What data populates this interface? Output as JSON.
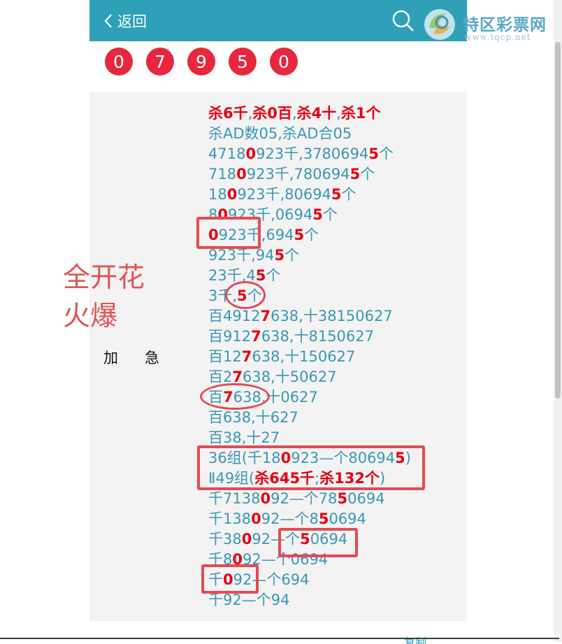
{
  "header": {
    "back_label": "返回",
    "logo_name": "特区彩票网",
    "logo_url": "www.tqcp.net"
  },
  "balls": [
    "0",
    "7",
    "9",
    "5",
    "0"
  ],
  "annotation": {
    "line1": "全开花",
    "line2": "火爆"
  },
  "urgent_label": "加急",
  "lines": [
    [
      [
        "杀6千",
        1
      ],
      [
        ",",
        0
      ],
      [
        "杀0百",
        1
      ],
      [
        ",",
        0
      ],
      [
        "杀4十",
        1
      ],
      [
        ",",
        0
      ],
      [
        "杀1个",
        1
      ]
    ],
    [
      [
        "杀AD数05,杀AD合05",
        0
      ]
    ],
    [
      [
        "4718",
        0
      ],
      [
        "0",
        1
      ],
      [
        "923千,3780694",
        0
      ],
      [
        "5",
        1
      ],
      [
        "个",
        0
      ]
    ],
    [
      [
        "718",
        0
      ],
      [
        "0",
        1
      ],
      [
        "923千,780694",
        0
      ],
      [
        "5",
        1
      ],
      [
        "个",
        0
      ]
    ],
    [
      [
        "18",
        0
      ],
      [
        "0",
        1
      ],
      [
        "923千,80694",
        0
      ],
      [
        "5",
        1
      ],
      [
        "个",
        0
      ]
    ],
    [
      [
        "8",
        0
      ],
      [
        "0",
        1
      ],
      [
        "923千,0694",
        0
      ],
      [
        "5",
        1
      ],
      [
        "个",
        0
      ]
    ],
    [
      [
        "0",
        1
      ],
      [
        "923千,694",
        0
      ],
      [
        "5",
        1
      ],
      [
        "个",
        0
      ]
    ],
    [
      [
        "923千,94",
        0
      ],
      [
        "5",
        1
      ],
      [
        "个",
        0
      ]
    ],
    [
      [
        "23千,4",
        0
      ],
      [
        "5",
        1
      ],
      [
        "个",
        0
      ]
    ],
    [
      [
        "3千,",
        0
      ],
      [
        "5",
        1
      ],
      [
        "个",
        0
      ]
    ],
    [
      [
        "百4912",
        0
      ],
      [
        "7",
        1
      ],
      [
        "638,十38150627",
        0
      ]
    ],
    [
      [
        "百912",
        0
      ],
      [
        "7",
        1
      ],
      [
        "638,十8150627",
        0
      ]
    ],
    [
      [
        "百12",
        0
      ],
      [
        "7",
        1
      ],
      [
        "638,十150627",
        0
      ]
    ],
    [
      [
        "百2",
        0
      ],
      [
        "7",
        1
      ],
      [
        "638,十50627",
        0
      ]
    ],
    [
      [
        "百",
        0
      ],
      [
        "7",
        1
      ],
      [
        "638,十0627",
        0
      ]
    ],
    [
      [
        "百638,十627",
        0
      ]
    ],
    [
      [
        "百38,十27",
        0
      ]
    ],
    [
      [
        "36组(千18",
        0
      ],
      [
        "0",
        1
      ],
      [
        "923—个80694",
        0
      ],
      [
        "5",
        1
      ],
      [
        ")",
        0
      ]
    ],
    [
      [
        "Ⅱ49组(",
        0
      ],
      [
        "杀645千",
        1
      ],
      [
        ";",
        0
      ],
      [
        "杀132个",
        1
      ],
      [
        ")",
        0
      ]
    ],
    [
      [
        "千7138",
        0
      ],
      [
        "0",
        1
      ],
      [
        "92—个78",
        0
      ],
      [
        "5",
        1
      ],
      [
        "0694",
        0
      ]
    ],
    [
      [
        "千138",
        0
      ],
      [
        "0",
        1
      ],
      [
        "92—个8",
        0
      ],
      [
        "5",
        1
      ],
      [
        "0694",
        0
      ]
    ],
    [
      [
        "千38",
        0
      ],
      [
        "0",
        1
      ],
      [
        "92—个",
        0
      ],
      [
        "5",
        1
      ],
      [
        "0694",
        0
      ]
    ],
    [
      [
        "千8",
        0
      ],
      [
        "0",
        1
      ],
      [
        "92—个0694",
        0
      ]
    ],
    [
      [
        "千",
        0
      ],
      [
        "0",
        1
      ],
      [
        "92—个694",
        0
      ]
    ],
    [
      [
        "千92—个94",
        0
      ]
    ]
  ],
  "bottom_label": "复制",
  "colors": {
    "header_bg": "#2ea0b8",
    "ball_red": "#e8273e",
    "text_teal": "#3a97b3",
    "highlight_red": "#e60012",
    "marker_red": "#e44b55"
  },
  "icons": [
    "chevron-left-icon",
    "search-icon",
    "site-logo-icon"
  ]
}
